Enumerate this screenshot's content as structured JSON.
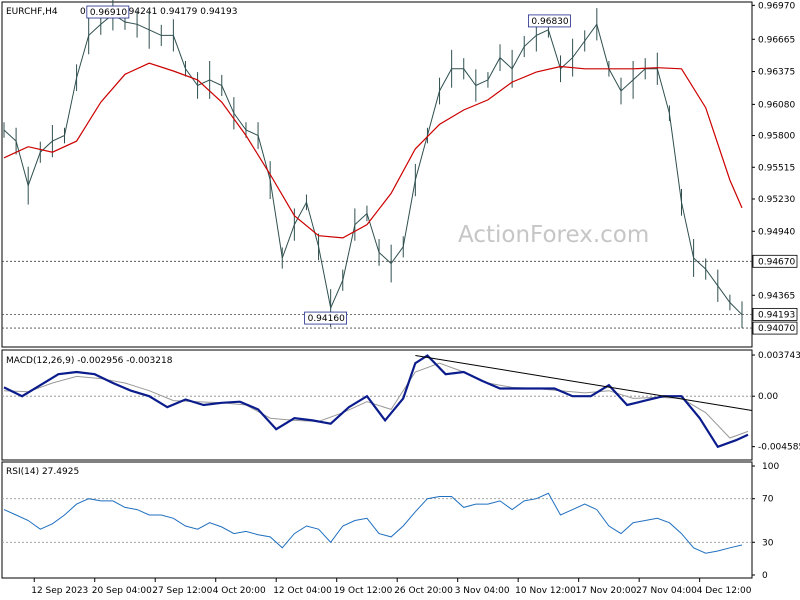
{
  "chart_data": [
    {
      "type": "line",
      "panel": "price",
      "symbol": "EURCHF,H4",
      "ohlc": "0.94224 0.94241 0.94179 0.94193",
      "watermark": "ActionForex.com",
      "ylim": [
        0.939,
        0.97
      ],
      "y_ticks": [
        "0.96970",
        "0.96665",
        "0.96375",
        "0.96080",
        "0.95800",
        "0.95515",
        "0.95230",
        "0.94940",
        "0.94365"
      ],
      "levels": [
        {
          "label": "0.94670",
          "value": 0.9467,
          "boxed": true
        },
        {
          "label": "0.94193",
          "value": 0.94193,
          "boxed": true
        },
        {
          "label": "0.94070",
          "value": 0.9407,
          "boxed": true
        }
      ],
      "callouts": [
        {
          "label": "0.96910",
          "x": 17,
          "value": 0.9691
        },
        {
          "label": "0.96830",
          "x": 90,
          "value": 0.9683
        },
        {
          "label": "0.94160",
          "x": 53,
          "value": 0.9416
        }
      ],
      "series": [
        {
          "name": "close",
          "color": "#2f4f4f",
          "x": [
            0,
            2,
            4,
            6,
            8,
            10,
            12,
            14,
            16,
            18,
            20,
            22,
            24,
            26,
            28,
            30,
            32,
            34,
            36,
            38,
            40,
            42,
            44,
            46,
            48,
            50,
            52,
            54,
            56,
            58,
            60,
            62,
            64,
            66,
            68,
            70,
            72,
            74,
            76,
            78,
            80,
            82,
            84,
            86,
            88,
            90,
            92,
            94,
            96,
            98,
            100,
            102,
            104,
            106,
            108,
            110,
            112,
            114,
            116,
            118,
            120,
            122
          ],
          "values": [
            0.9585,
            0.9575,
            0.9535,
            0.9565,
            0.9575,
            0.958,
            0.9632,
            0.967,
            0.968,
            0.9689,
            0.9682,
            0.968,
            0.9675,
            0.967,
            0.967,
            0.964,
            0.9625,
            0.963,
            0.9625,
            0.96,
            0.9585,
            0.958,
            0.954,
            0.947,
            0.95,
            0.952,
            0.948,
            0.9425,
            0.945,
            0.95,
            0.951,
            0.9475,
            0.9465,
            0.948,
            0.954,
            0.958,
            0.962,
            0.964,
            0.964,
            0.9625,
            0.963,
            0.965,
            0.964,
            0.966,
            0.967,
            0.9675,
            0.964,
            0.965,
            0.9665,
            0.968,
            0.964,
            0.962,
            0.963,
            0.964,
            0.964,
            0.96,
            0.952,
            0.947,
            0.946,
            0.9445,
            0.943,
            0.9419
          ]
        },
        {
          "name": "moving average",
          "color": "#cc0000",
          "x": [
            0,
            4,
            8,
            12,
            16,
            20,
            24,
            28,
            32,
            36,
            40,
            44,
            48,
            52,
            56,
            60,
            64,
            68,
            72,
            76,
            80,
            84,
            88,
            92,
            96,
            100,
            104,
            108,
            112,
            116,
            120,
            122
          ],
          "values": [
            0.956,
            0.957,
            0.9565,
            0.9575,
            0.961,
            0.9635,
            0.9645,
            0.9638,
            0.963,
            0.961,
            0.958,
            0.9545,
            0.9508,
            0.949,
            0.9488,
            0.95,
            0.9528,
            0.9568,
            0.959,
            0.9603,
            0.9612,
            0.9628,
            0.9637,
            0.9642,
            0.964,
            0.964,
            0.964,
            0.9641,
            0.964,
            0.9605,
            0.954,
            0.9515
          ]
        }
      ]
    },
    {
      "type": "line",
      "panel": "macd",
      "title": "MACD(12,26,9) -0.002956 -0.003218",
      "ylim": [
        -0.0058,
        0.0042
      ],
      "y_ticks": [
        {
          "label": "0.003743",
          "value": 0.003743
        },
        {
          "label": "0.00",
          "value": 0
        },
        {
          "label": "-0.004585",
          "value": -0.004585
        }
      ],
      "trendline": {
        "x": [
          68,
          124
        ],
        "values": [
          0.0037,
          -0.0013
        ]
      },
      "series": [
        {
          "name": "MACD",
          "color": "#0b1c8c",
          "x": [
            0,
            3,
            6,
            9,
            12,
            15,
            18,
            21,
            24,
            27,
            30,
            33,
            36,
            39,
            42,
            45,
            48,
            51,
            54,
            57,
            60,
            63,
            66,
            68,
            70,
            73,
            76,
            79,
            82,
            85,
            88,
            91,
            94,
            97,
            100,
            103,
            106,
            109,
            112,
            115,
            118,
            121,
            123
          ],
          "values": [
            0.0008,
            0.0,
            0.001,
            0.002,
            0.0022,
            0.002,
            0.0012,
            0.0005,
            0.0,
            -0.001,
            -0.0003,
            -0.0008,
            -0.0006,
            -0.0005,
            -0.0012,
            -0.003,
            -0.002,
            -0.0022,
            -0.0025,
            -0.001,
            0.0,
            -0.0022,
            -0.0002,
            0.003,
            0.0037,
            0.002,
            0.0022,
            0.0014,
            0.0007,
            0.0007,
            0.0007,
            0.0007,
            0.0,
            0.0,
            0.001,
            -0.0008,
            -0.0004,
            0.0,
            0.0,
            -0.002,
            -0.0046,
            -0.004,
            -0.0035
          ]
        },
        {
          "name": "Signal",
          "color": "#999999",
          "x": [
            0,
            4,
            8,
            12,
            16,
            20,
            24,
            28,
            32,
            36,
            40,
            44,
            48,
            52,
            56,
            60,
            64,
            68,
            72,
            76,
            80,
            84,
            88,
            92,
            96,
            100,
            104,
            108,
            112,
            116,
            120,
            123
          ],
          "values": [
            0.0005,
            0.0004,
            0.0012,
            0.0018,
            0.0016,
            0.0012,
            0.0005,
            -0.0004,
            -0.0005,
            -0.0006,
            -0.0008,
            -0.002,
            -0.0022,
            -0.0023,
            -0.0015,
            -0.0005,
            -0.0012,
            0.0022,
            0.003,
            0.0022,
            0.0012,
            0.0008,
            0.0007,
            0.0005,
            0.0003,
            0.0005,
            -0.0002,
            -0.0001,
            -0.0002,
            -0.0015,
            -0.0038,
            -0.0032
          ]
        }
      ]
    },
    {
      "type": "line",
      "panel": "rsi",
      "title": "RSI(14) 27.4925",
      "ylim": [
        0,
        100
      ],
      "y_ticks": [
        {
          "label": "100",
          "value": 100
        },
        {
          "label": "70",
          "value": 70
        },
        {
          "label": "30",
          "value": 30
        },
        {
          "label": "0",
          "value": 0
        }
      ],
      "levels": [
        70,
        30
      ],
      "series": [
        {
          "name": "RSI",
          "color": "#1f6fc0",
          "x": [
            0,
            2,
            4,
            6,
            8,
            10,
            12,
            14,
            16,
            18,
            20,
            22,
            24,
            26,
            28,
            30,
            32,
            34,
            36,
            38,
            40,
            42,
            44,
            46,
            48,
            50,
            52,
            54,
            56,
            58,
            60,
            62,
            64,
            66,
            68,
            70,
            72,
            74,
            76,
            78,
            80,
            82,
            84,
            86,
            88,
            90,
            92,
            94,
            96,
            98,
            100,
            102,
            104,
            106,
            108,
            110,
            112,
            114,
            116,
            118,
            120,
            122
          ],
          "values": [
            60,
            55,
            50,
            42,
            47,
            55,
            65,
            70,
            68,
            68,
            62,
            60,
            55,
            55,
            52,
            45,
            42,
            48,
            44,
            38,
            40,
            37,
            35,
            25,
            38,
            45,
            42,
            30,
            45,
            50,
            52,
            38,
            35,
            45,
            58,
            70,
            72,
            72,
            62,
            65,
            65,
            68,
            60,
            68,
            70,
            75,
            55,
            60,
            65,
            60,
            45,
            38,
            48,
            50,
            52,
            48,
            38,
            25,
            20,
            22,
            25,
            27.5
          ]
        }
      ]
    }
  ],
  "x_axis": {
    "x_range": [
      0,
      122
    ],
    "ticks": [
      {
        "label": "12 Sep 2023",
        "x": 5
      },
      {
        "label": "20 Sep 04:00",
        "x": 15
      },
      {
        "label": "27 Sep 12:00",
        "x": 25
      },
      {
        "label": "4 Oct 20:00",
        "x": 35
      },
      {
        "label": "12 Oct 04:00",
        "x": 45
      },
      {
        "label": "19 Oct 12:00",
        "x": 55
      },
      {
        "label": "26 Oct 20:00",
        "x": 65
      },
      {
        "label": "3 Nov 04:00",
        "x": 75
      },
      {
        "label": "10 Nov 12:00",
        "x": 85
      },
      {
        "label": "17 Nov 20:00",
        "x": 95
      },
      {
        "label": "27 Nov 04:00",
        "x": 105
      },
      {
        "label": "4 Dec 12:00",
        "x": 115
      }
    ]
  }
}
